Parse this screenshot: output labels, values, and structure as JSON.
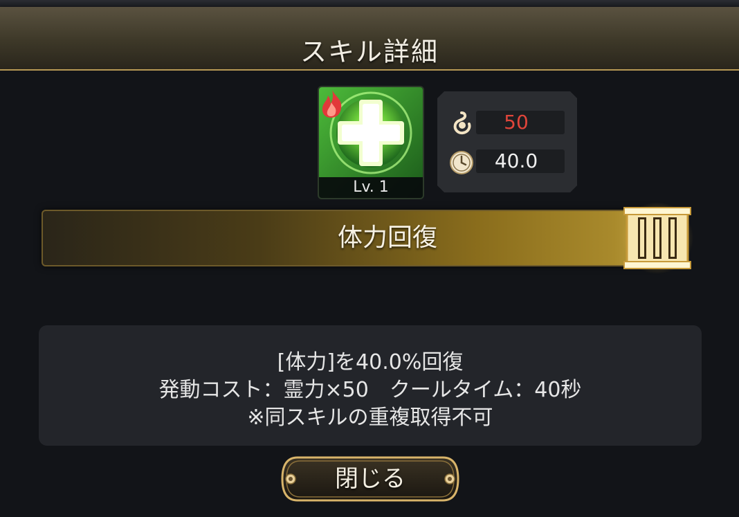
{
  "header": {
    "title": "スキル詳細"
  },
  "skill": {
    "icon": "green-cross-heal-icon",
    "badge_icon": "fire-badge-icon",
    "level_label": "Lv. 1",
    "name": "体力回復",
    "rank": "III"
  },
  "stats": {
    "cost": {
      "icon": "spirit-flame-icon",
      "value": "50",
      "color": "#e0453a"
    },
    "cooldown": {
      "icon": "clock-icon",
      "value": "40.0",
      "color": "#f0f0f0"
    }
  },
  "description": {
    "lines": [
      "[体力]を40.0%回復",
      "発動コスト：霊力×50　クールタイム：40秒",
      "※同スキルの重複取得不可"
    ]
  },
  "close_button": {
    "label": "閉じる"
  },
  "colors": {
    "accent_gold": "#c7a94a",
    "panel_bg": "#121418",
    "skill_green": "#3fae3a"
  }
}
